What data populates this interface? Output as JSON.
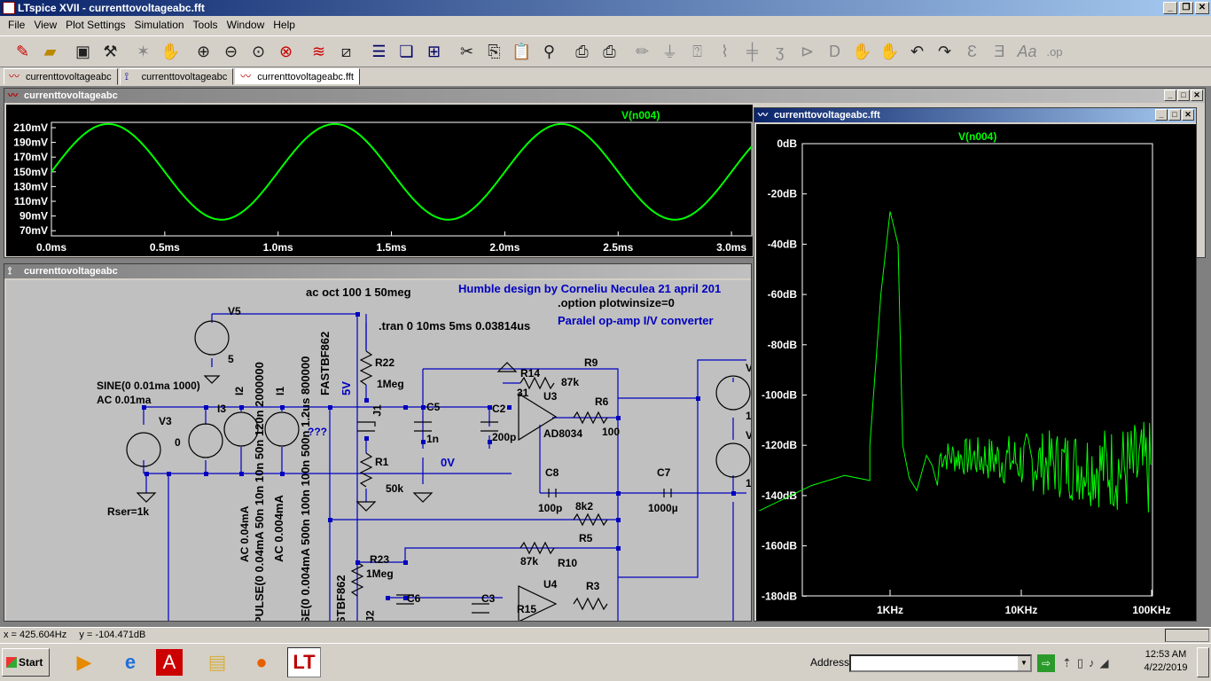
{
  "titlebar": {
    "title": "LTspice XVII - currenttovoltageabc.fft",
    "min": "_",
    "restore": "❐",
    "close": "✕"
  },
  "menu": [
    "File",
    "View",
    "Plot Settings",
    "Simulation",
    "Tools",
    "Window",
    "Help"
  ],
  "toolbar_icons": [
    "new-schematic-icon",
    "open-icon",
    "save-icon",
    "control-panel-icon",
    "run-icon",
    "halt-icon",
    "zoom-in-icon",
    "zoom-out-icon",
    "zoom-fit-icon",
    "zoom-cancel-icon",
    "autorange-icon",
    "pick-visible-icon",
    "tile-horizontal-icon",
    "cascade-icon",
    "tile-vertical-icon",
    "cut-icon",
    "copy-icon",
    "paste-icon",
    "find-icon",
    "print-icon",
    "print-setup-icon",
    "draw-wire-icon",
    "ground-icon",
    "label-net-icon",
    "resistor-icon",
    "capacitor-icon",
    "inductor-icon",
    "diode-icon",
    "component-icon",
    "move-icon",
    "drag-icon",
    "undo-icon",
    "redo-icon",
    "rotate-icon",
    "mirror-icon",
    "text-icon",
    "spice-directive-icon"
  ],
  "tabs": [
    {
      "label": "currenttovoltageabc",
      "icon": "waveform-icon"
    },
    {
      "label": "currenttovoltageabc",
      "icon": "schematic-icon"
    },
    {
      "label": "currenttovoltageabc.fft",
      "icon": "waveform-icon"
    }
  ],
  "wave_window": {
    "title": "currenttovoltageabc",
    "trace": "V(n004)",
    "trace_color": "#00ff00",
    "y_ticks": [
      "210mV",
      "190mV",
      "170mV",
      "150mV",
      "130mV",
      "110mV",
      "90mV",
      "70mV"
    ],
    "x_ticks": [
      "0.0ms",
      "0.5ms",
      "1.0ms",
      "1.5ms",
      "2.0ms",
      "2.5ms",
      "3.0ms"
    ]
  },
  "schematic_window": {
    "title": "currenttovoltageabc",
    "texts": {
      "ac_cmd": "ac oct 100 1 50meg",
      "humble": "Humble design by Corneliu Neculea 21 april 201",
      "option": ".option plotwinsize=0",
      "tran": ".tran 0 10ms 5ms 0.03814us",
      "paralel": "Paralel op-amp I/V converter",
      "v5": "V5",
      "v5_val": "5",
      "fast": "FASTBF862",
      "r22": "R22",
      "r22_val": "1Meg",
      "fivev": "5V",
      "r14": "R14",
      "r9": "R9",
      "r9_val": "87k",
      "n31": "31",
      "u3": "U3",
      "r6": "R6",
      "r6_val": "100",
      "ad": "AD8034",
      "sine": "SINE(0 0.01ma 1000)",
      "ac01": "AC 0.01ma",
      "i2": "I2",
      "i1": "I1",
      "i3": "I3",
      "v3": "V3",
      "v3_val": "0",
      "j1": "J1",
      "c5": "C5",
      "c5_val": "1n",
      "c2": "C2",
      "c2_val": "200p",
      "qqq": "???",
      "r1": "R1",
      "r1_val": "50k",
      "zero_v": "0V",
      "c8": "C8",
      "c8_val": "100p",
      "c7": "C7",
      "c7_val": "1000µ",
      "r5_val": "8k2",
      "r5": "R5",
      "rser": "Rser=1k",
      "vert_ac004": "AC 0.04mA",
      "vert_pulse": "PULSE(0 0.04mA 50n 10n 10n 50n 120n 2000000",
      "vert_ac0004": "AC 0.004mA",
      "vert_pulse2": "SE(0 0.004mA 500n 100n 100n 500n 1.2us 800000",
      "vert_stbf": "STBF862",
      "r23": "R23",
      "r23_val": "1Meg",
      "j2": "J2",
      "r10_val": "87k",
      "r10": "R10",
      "u4": "U4",
      "c6": "C6",
      "c3": "C3",
      "r3": "R3",
      "r15": "R15",
      "v_right": "V",
      "v_right2": "V",
      "one_a": "1",
      "one_b": "1"
    }
  },
  "fft_window": {
    "title": "currenttovoltageabc.fft",
    "trace": "V(n004)",
    "y_ticks": [
      "0dB",
      "-20dB",
      "-40dB",
      "-60dB",
      "-80dB",
      "-100dB",
      "-120dB",
      "-140dB",
      "-160dB",
      "-180dB"
    ],
    "x_ticks": [
      "1KHz",
      "10KHz",
      "100KHz"
    ]
  },
  "statusbar": {
    "x": "x = 425.604Hz",
    "y": "y = -104.471dB"
  },
  "taskbar": {
    "start": "Start",
    "address_label": "Address",
    "time": "12:53 AM",
    "date": "4/22/2019"
  }
}
